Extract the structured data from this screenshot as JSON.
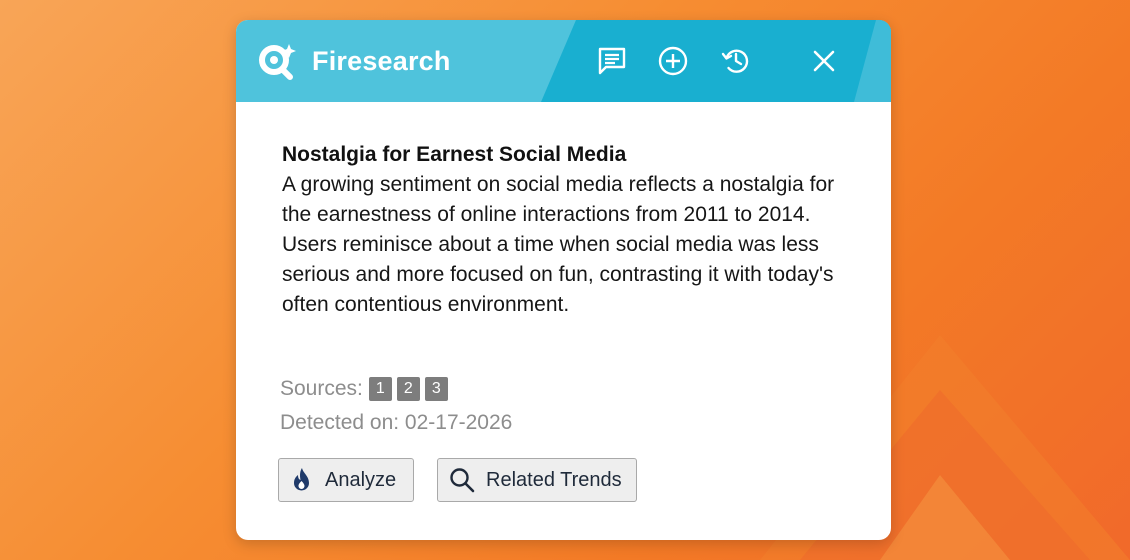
{
  "background": {
    "gradient_start": "#f8a557",
    "gradient_end": "#f1692a"
  },
  "header": {
    "brand_name": "Firesearch",
    "color": "#4fc3dc",
    "color_dark": "#1ab0d0",
    "icons": [
      "chat-icon",
      "plus-circle-icon",
      "history-icon",
      "close-icon"
    ]
  },
  "trend": {
    "title": "Nostalgia for Earnest Social Media",
    "description": "A growing sentiment on social media reflects a nostalgia for the earnestness of online interactions from 2011 to 2014. Users reminisce about a time when social media was less serious and more focused on fun, contrasting it with today's often contentious environment."
  },
  "meta": {
    "sources_label": "Sources:",
    "sources": [
      "1",
      "2",
      "3"
    ],
    "detected_label": "Detected on: 02-17-2026"
  },
  "actions": {
    "analyze_label": "Analyze",
    "related_label": "Related Trends"
  }
}
